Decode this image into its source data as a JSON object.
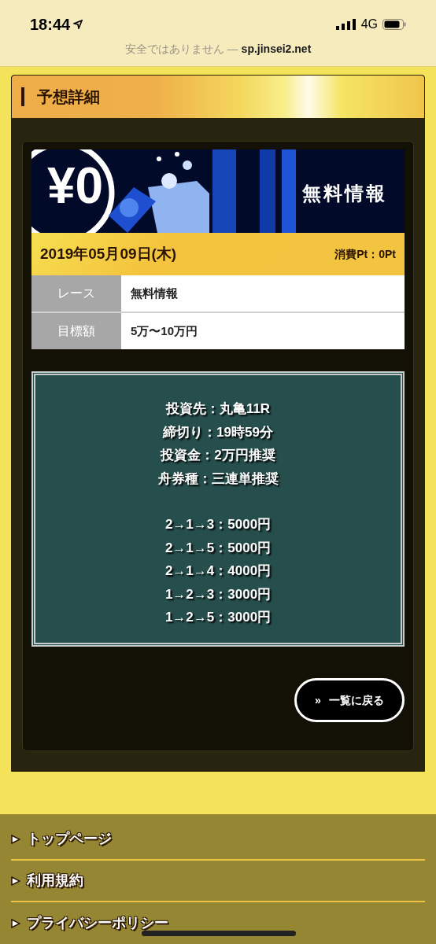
{
  "status_bar": {
    "time": "18:44",
    "network": "4G"
  },
  "url_bar": {
    "warning": "安全ではありません —",
    "domain": "sp.jinsei2.net"
  },
  "panel": {
    "title": "予想詳細"
  },
  "banner": {
    "kind": "picture",
    "price": "¥0",
    "title": "無料情報"
  },
  "date_bar": {
    "date": "2019年05月09日(木)",
    "points": "消費Pt：0Pt"
  },
  "info_table": [
    {
      "label": "レース",
      "value": "無料情報"
    },
    {
      "label": "目標額",
      "value": "5万〜10万円"
    }
  ],
  "forecast": {
    "details": [
      "投資先：丸亀11R",
      "締切り：19時59分",
      "投資金：2万円推奨",
      "舟券種：三連単推奨"
    ],
    "bets": [
      "2→1→3：5000円",
      "2→1→5：5000円",
      "2→1→4：4000円",
      "1→2→3：3000円",
      "1→2→5：3000円"
    ]
  },
  "back_button": {
    "icon": "»",
    "label": "一覧に戻る"
  },
  "footer_links": [
    "トップページ",
    "利用規約",
    "プライバシーポリシー"
  ]
}
